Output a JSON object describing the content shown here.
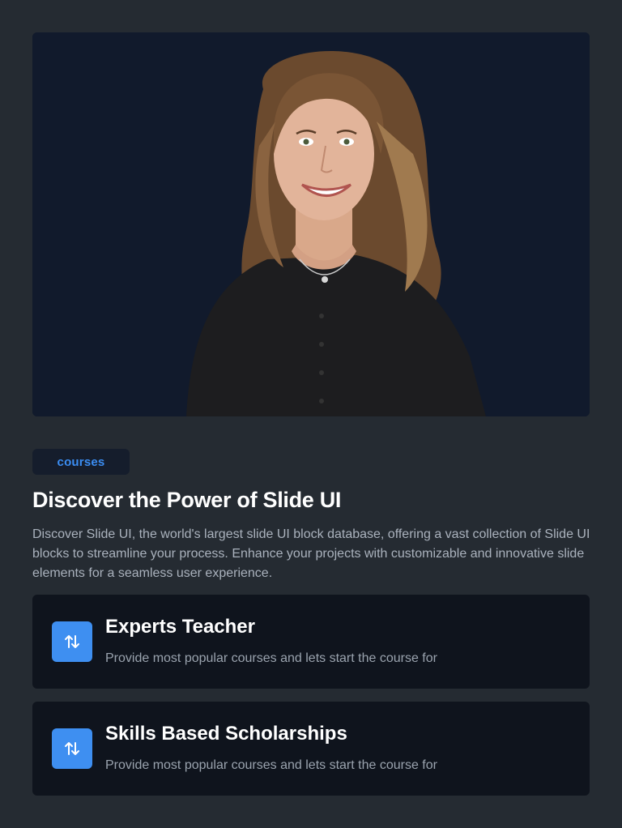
{
  "hero": {
    "image_description_icon": "portrait-photo"
  },
  "badge": {
    "label": "courses"
  },
  "heading": {
    "title": "Discover the Power of Slide UI",
    "description": "Discover Slide UI, the world's largest slide UI block database, offering a vast collection of Slide UI blocks to streamline your process. Enhance your projects with customizable and innovative slide elements for a seamless user experience."
  },
  "features": [
    {
      "icon": "arrows-up-down-icon",
      "title": "Experts Teacher",
      "text": "Provide most popular courses and lets start the course for"
    },
    {
      "icon": "arrows-up-down-icon",
      "title": "Skills Based Scholarships",
      "text": "Provide most popular courses and lets start the course for"
    }
  ],
  "colors": {
    "background": "#252b32",
    "hero_bg": "#111a2c",
    "accent": "#3e8ff1",
    "card_bg": "#0f141d"
  }
}
